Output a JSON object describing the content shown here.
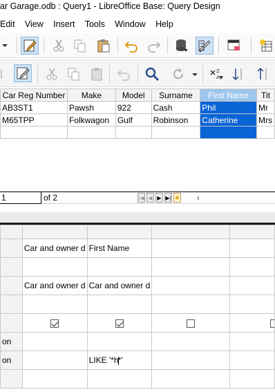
{
  "window": {
    "title": "ar Garage.odb : Query1 - LibreOffice Base: Query Design"
  },
  "menu": {
    "items": [
      "Edit",
      "View",
      "Insert",
      "Tools",
      "Window",
      "Help"
    ]
  },
  "results": {
    "columns": [
      "Car Reg Number",
      "Make",
      "Model",
      "Surname",
      "First Name",
      "Tit"
    ],
    "rows": [
      [
        "AB3ST1",
        "Pawsh",
        "922",
        "Cash",
        "Phil",
        "Mr"
      ],
      [
        "M65TPP",
        "Folkwagon",
        "Gulf",
        "Robinson",
        "Catherine",
        "Mrs"
      ],
      [
        "",
        "",
        "",
        "",
        "",
        ""
      ]
    ],
    "selected_column": "First Name"
  },
  "navigator": {
    "record_value": "1",
    "of_label": "of 2"
  },
  "design": {
    "row_labels": [
      "",
      "",
      "",
      "",
      "",
      "on",
      "on",
      ""
    ],
    "columns": [
      {
        "field": "Car and owner d",
        "table": "Car and owner d",
        "visible": true,
        "criterion": ""
      },
      {
        "field": "First Name",
        "table": "Car and owner d",
        "visible": true,
        "criterion": "LIKE '*h*'"
      },
      {
        "field": "",
        "table": "",
        "visible": false,
        "criterion": ""
      },
      {
        "field": "",
        "table": "",
        "visible": false,
        "criterion": ""
      }
    ],
    "criterion_before_cursor": "LIKE '*h",
    "criterion_after_cursor": "*'"
  }
}
